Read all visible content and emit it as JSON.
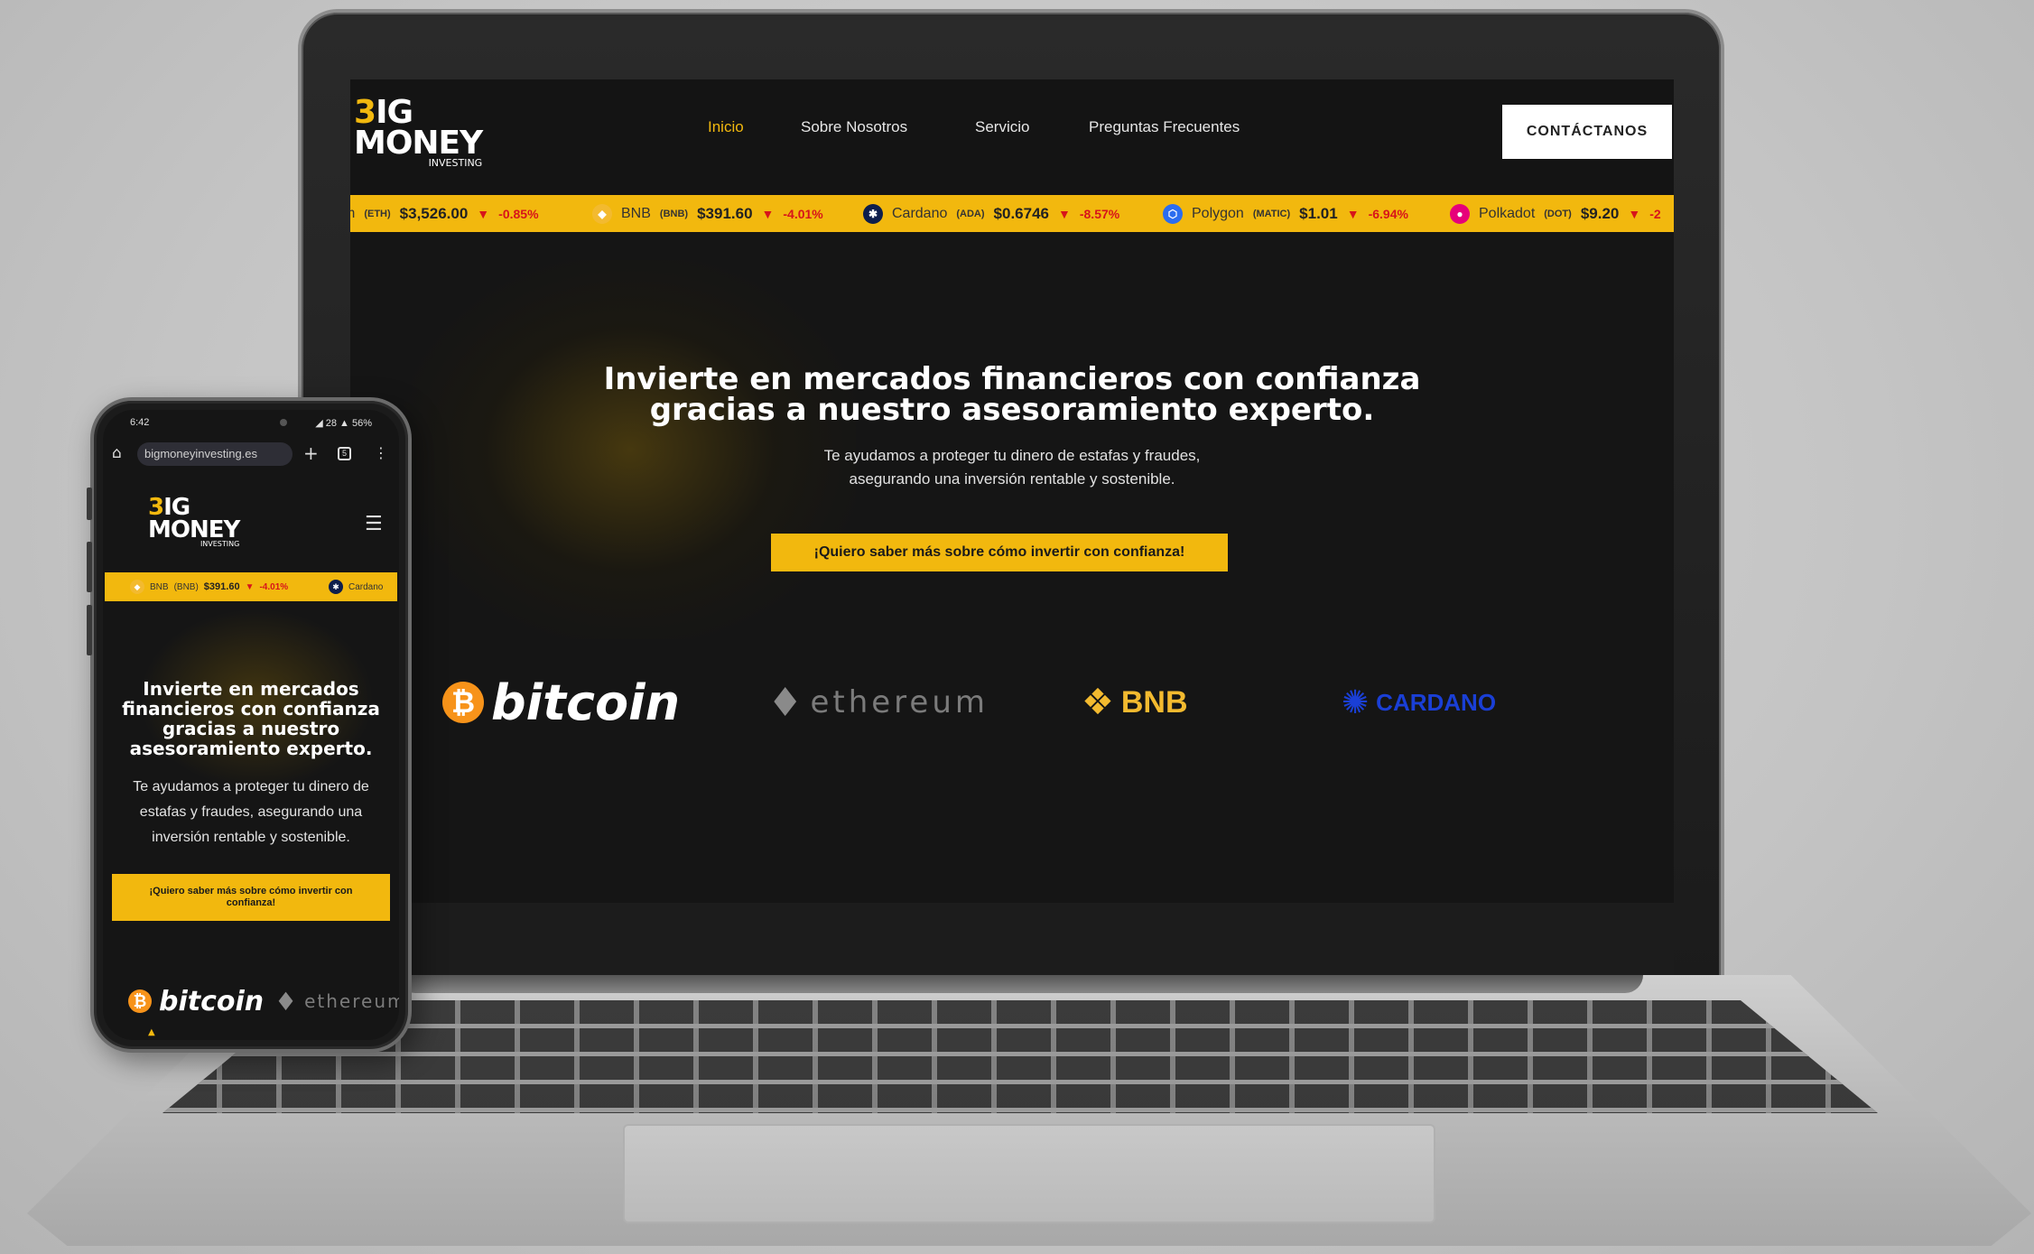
{
  "site": {
    "logo": {
      "line1_b": "3",
      "line1_rest": "IG",
      "line2": "MONEY",
      "line3": "INVESTING"
    },
    "nav": [
      {
        "label": "Inicio",
        "active": true
      },
      {
        "label": "Sobre Nosotros",
        "active": false
      },
      {
        "label": "Servicio",
        "active": false
      },
      {
        "label": "Preguntas Frecuentes",
        "active": false
      }
    ],
    "contact_label": "CONTÁCTANOS",
    "ticker": [
      {
        "name": "m",
        "symbol": "(ETH)",
        "price": "$3,526.00",
        "change": "-0.85%",
        "icon": "ethereum-icon",
        "color": "#627eea"
      },
      {
        "name": "BNB",
        "symbol": "(BNB)",
        "price": "$391.60",
        "change": "-4.01%",
        "icon": "bnb-icon",
        "color": "#f3ba2f"
      },
      {
        "name": "Cardano",
        "symbol": "(ADA)",
        "price": "$0.6746",
        "change": "-8.57%",
        "icon": "cardano-icon",
        "color": "#0d1e4c"
      },
      {
        "name": "Polygon",
        "symbol": "(MATIC)",
        "price": "$1.01",
        "change": "-6.94%",
        "icon": "polygon-icon",
        "color": "#2b6def"
      },
      {
        "name": "Polkadot",
        "symbol": "(DOT)",
        "price": "$9.20",
        "change": "-2",
        "icon": "polkadot-icon",
        "color": "#e6007a"
      }
    ],
    "hero": {
      "title_line1": "Invierte en mercados financieros con confianza",
      "title_line2": "gracias a nuestro asesoramiento experto.",
      "sub_line1": "Te ayudamos a proteger tu dinero de estafas y fraudes,",
      "sub_line2": "asegurando una inversión rentable y sostenible.",
      "cta": "¡Quiero saber más sobre cómo invertir con confianza!"
    },
    "brands": {
      "bitcoin": "bitcoin",
      "ethereum": "ethereum",
      "bnb": "BNB",
      "cardano": "CARDANO"
    }
  },
  "mobile": {
    "status_time": "6:42",
    "status_right": "◢ 28 ▲ 56%",
    "url": "bigmoneyinvesting.es",
    "tab_count": "5",
    "ticker": [
      {
        "name": "BNB",
        "symbol": "(BNB)",
        "price": "$391.60",
        "change": "-4.01%"
      },
      {
        "name": "Cardano",
        "symbol": "",
        "price": "",
        "change": ""
      }
    ],
    "title": "Invierte en mercados financieros con confianza gracias a nuestro asesoramiento experto.",
    "sub": "Te ayudamos a proteger tu dinero de estafas y fraudes, asegurando una inversión rentable y sostenible.",
    "cta": "¡Quiero saber más sobre cómo invertir con confianza!"
  },
  "colors": {
    "accent": "#f2b80e",
    "background": "#151515",
    "negative": "#d7141a"
  }
}
